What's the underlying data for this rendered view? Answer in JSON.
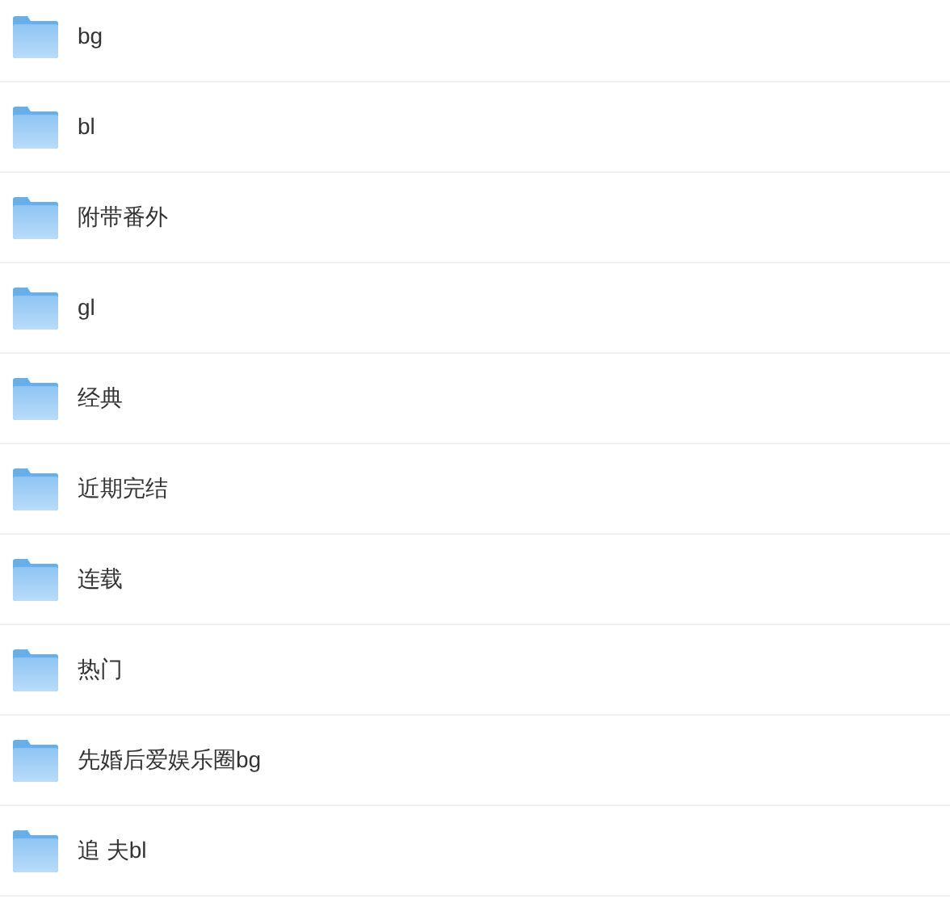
{
  "folders": [
    {
      "name": "bg"
    },
    {
      "name": "bl"
    },
    {
      "name": "附带番外"
    },
    {
      "name": "gl"
    },
    {
      "name": "经典"
    },
    {
      "name": "近期完结"
    },
    {
      "name": "连载"
    },
    {
      "name": "热门"
    },
    {
      "name": "先婚后爱娱乐圈bg"
    },
    {
      "name": "追 夫bl"
    }
  ]
}
